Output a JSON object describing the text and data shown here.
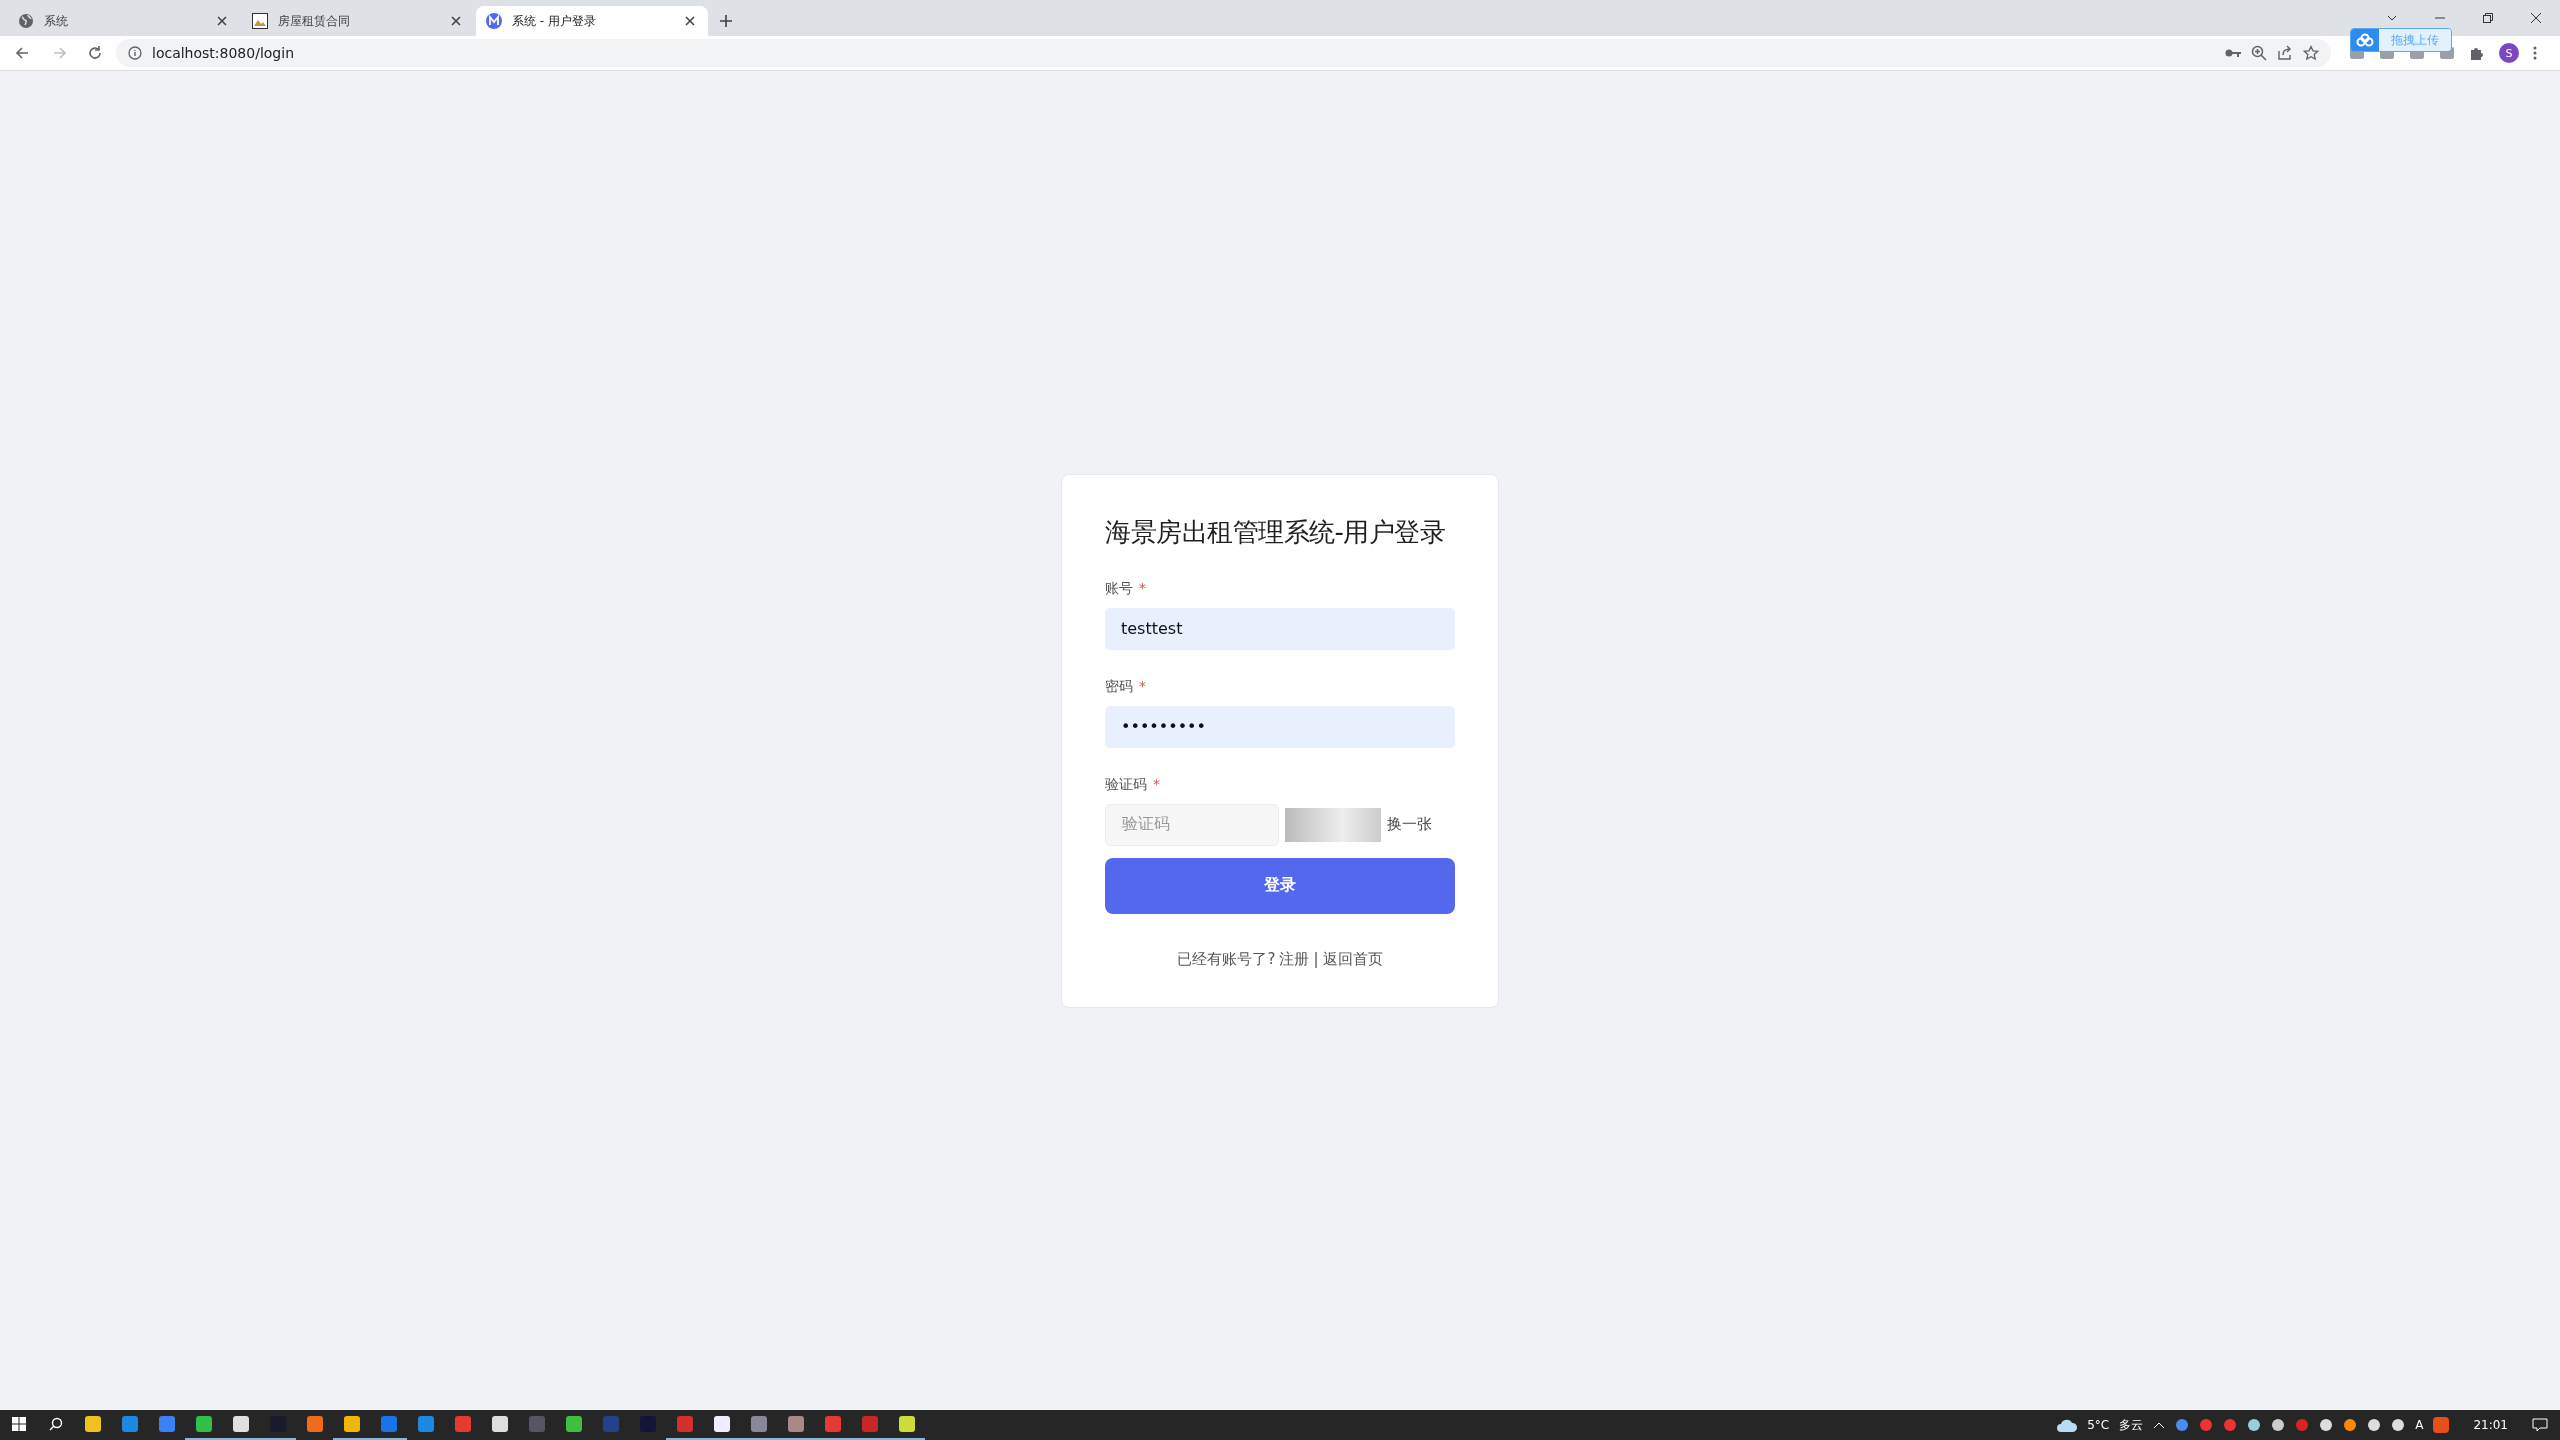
{
  "browser": {
    "tabs": [
      {
        "title": "系统",
        "kind": "globe",
        "selected": false
      },
      {
        "title": "房屋租赁合同",
        "kind": "picture",
        "selected": false
      },
      {
        "title": "系统 - 用户登录",
        "kind": "logo",
        "selected": true
      }
    ],
    "address": "localhost:8080/login",
    "profile_initial": "S"
  },
  "upload_badge": {
    "label": "拖拽上传"
  },
  "login": {
    "title": "海景房出租管理系统-用户登录",
    "fields": [
      {
        "kind": "text",
        "label": "账号",
        "required_mark": "*",
        "value": "testtest"
      },
      {
        "kind": "text",
        "label": "密码",
        "required_mark": "*",
        "value": "•••••••••"
      },
      {
        "kind": "captcha",
        "label": "验证码",
        "required_mark": "*",
        "placeholder": "验证码",
        "refresh": "换一张"
      }
    ],
    "submit": "登录",
    "footer": {
      "prompt": "已经有账号了?",
      "register": "注册",
      "separator": "|",
      "home": "返回首页"
    }
  },
  "taskbar": {
    "apps": [
      {
        "running": false
      },
      {
        "running": false
      },
      {
        "running": false
      },
      {
        "running": true
      },
      {
        "running": true
      },
      {
        "running": true
      },
      {
        "running": false
      },
      {
        "running": true
      },
      {
        "running": true
      },
      {
        "running": false
      },
      {
        "running": false
      },
      {
        "running": false
      },
      {
        "running": false
      },
      {
        "running": false
      },
      {
        "running": false
      },
      {
        "running": false
      },
      {
        "running": true
      },
      {
        "running": true
      },
      {
        "running": true
      },
      {
        "running": true
      },
      {
        "running": true
      },
      {
        "running": true
      },
      {
        "running": true
      }
    ],
    "weather": {
      "temperature": "5°C",
      "condition": "多云"
    },
    "ime": "A",
    "clock": "21:01"
  }
}
